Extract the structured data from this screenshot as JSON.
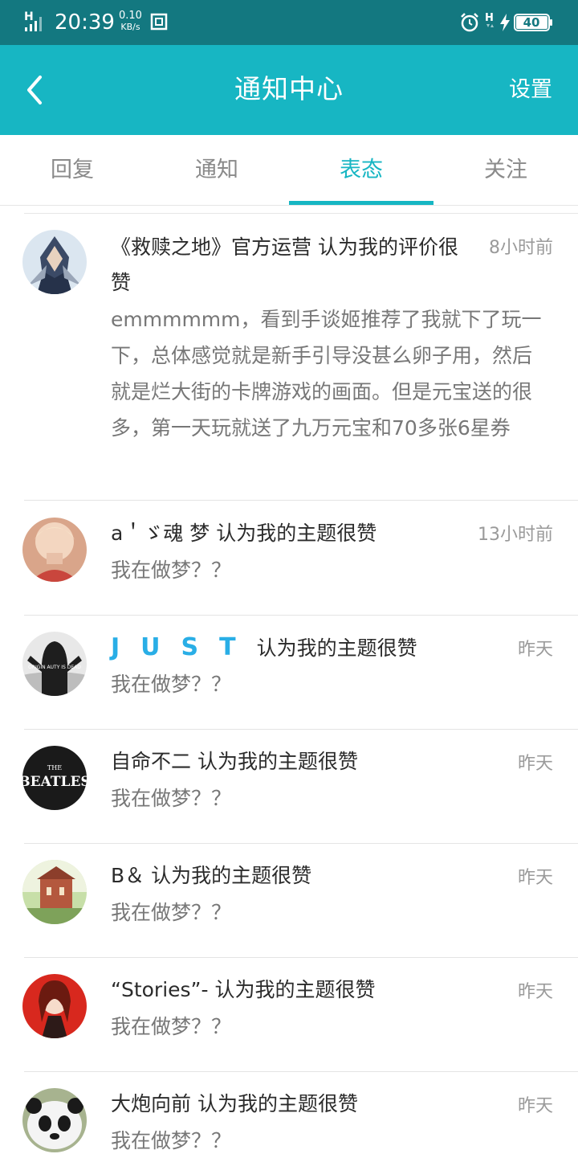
{
  "status_bar": {
    "time": "20:39",
    "speed_value": "0.10",
    "speed_unit": "KB/s",
    "battery": "40",
    "network_letter": "H"
  },
  "header": {
    "title": "通知中心",
    "settings": "设置"
  },
  "tabs": [
    {
      "label": "回复",
      "active": false
    },
    {
      "label": "通知",
      "active": false
    },
    {
      "label": "表态",
      "active": true
    },
    {
      "label": "关注",
      "active": false
    }
  ],
  "colors": {
    "accent": "#17b6c3",
    "status_bar": "#137880",
    "just_blue": "#29aee6"
  },
  "notifications": [
    {
      "name": "《救赎之地》官方运营",
      "action": "认为我的评价很赞",
      "time": "8小时前",
      "body": "emmmmmm，看到手谈姬推荐了我就下了玩一下，总体感觉就是新手引导没甚么卵子用，然后就是烂大街的卡牌游戏的画面。但是元宝送的很多，第一天玩就送了九万元宝和70多张6星券"
    },
    {
      "name": "a＇ゞ魂 梦",
      "action": "认为我的主题很赞",
      "time": "13小时前",
      "body": "我在做梦？？"
    },
    {
      "name": "JUST",
      "action": "认为我的主题很赞",
      "time": "昨天",
      "body": "我在做梦？？"
    },
    {
      "name": "自命不二",
      "action": "认为我的主题很赞",
      "time": "昨天",
      "body": "我在做梦？？"
    },
    {
      "name": "B＆",
      "action": "认为我的主题很赞",
      "time": "昨天",
      "body": "我在做梦？？"
    },
    {
      "name": "“Stories”-",
      "action": "认为我的主题很赞",
      "time": "昨天",
      "body": "我在做梦？？"
    },
    {
      "name": "大炮向前",
      "action": "认为我的主题很赞",
      "time": "昨天",
      "body": "我在做梦？？"
    }
  ],
  "avatars": {
    "beatles_the": "THE",
    "beatles_name": "BEATLES",
    "hoodie_text": "ORIGIN AUTY IS DEAD"
  }
}
